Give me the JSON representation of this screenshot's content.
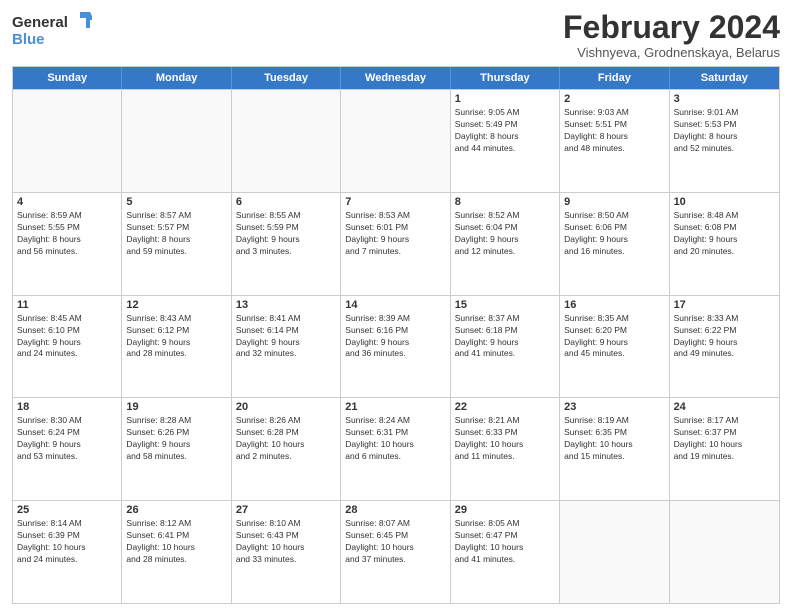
{
  "header": {
    "logo_line1": "General",
    "logo_line2": "Blue",
    "month_title": "February 2024",
    "location": "Vishnyeva, Grodnenskaya, Belarus"
  },
  "days_of_week": [
    "Sunday",
    "Monday",
    "Tuesday",
    "Wednesday",
    "Thursday",
    "Friday",
    "Saturday"
  ],
  "weeks": [
    [
      {
        "day": "",
        "info": ""
      },
      {
        "day": "",
        "info": ""
      },
      {
        "day": "",
        "info": ""
      },
      {
        "day": "",
        "info": ""
      },
      {
        "day": "1",
        "info": "Sunrise: 9:05 AM\nSunset: 5:49 PM\nDaylight: 8 hours\nand 44 minutes."
      },
      {
        "day": "2",
        "info": "Sunrise: 9:03 AM\nSunset: 5:51 PM\nDaylight: 8 hours\nand 48 minutes."
      },
      {
        "day": "3",
        "info": "Sunrise: 9:01 AM\nSunset: 5:53 PM\nDaylight: 8 hours\nand 52 minutes."
      }
    ],
    [
      {
        "day": "4",
        "info": "Sunrise: 8:59 AM\nSunset: 5:55 PM\nDaylight: 8 hours\nand 56 minutes."
      },
      {
        "day": "5",
        "info": "Sunrise: 8:57 AM\nSunset: 5:57 PM\nDaylight: 8 hours\nand 59 minutes."
      },
      {
        "day": "6",
        "info": "Sunrise: 8:55 AM\nSunset: 5:59 PM\nDaylight: 9 hours\nand 3 minutes."
      },
      {
        "day": "7",
        "info": "Sunrise: 8:53 AM\nSunset: 6:01 PM\nDaylight: 9 hours\nand 7 minutes."
      },
      {
        "day": "8",
        "info": "Sunrise: 8:52 AM\nSunset: 6:04 PM\nDaylight: 9 hours\nand 12 minutes."
      },
      {
        "day": "9",
        "info": "Sunrise: 8:50 AM\nSunset: 6:06 PM\nDaylight: 9 hours\nand 16 minutes."
      },
      {
        "day": "10",
        "info": "Sunrise: 8:48 AM\nSunset: 6:08 PM\nDaylight: 9 hours\nand 20 minutes."
      }
    ],
    [
      {
        "day": "11",
        "info": "Sunrise: 8:45 AM\nSunset: 6:10 PM\nDaylight: 9 hours\nand 24 minutes."
      },
      {
        "day": "12",
        "info": "Sunrise: 8:43 AM\nSunset: 6:12 PM\nDaylight: 9 hours\nand 28 minutes."
      },
      {
        "day": "13",
        "info": "Sunrise: 8:41 AM\nSunset: 6:14 PM\nDaylight: 9 hours\nand 32 minutes."
      },
      {
        "day": "14",
        "info": "Sunrise: 8:39 AM\nSunset: 6:16 PM\nDaylight: 9 hours\nand 36 minutes."
      },
      {
        "day": "15",
        "info": "Sunrise: 8:37 AM\nSunset: 6:18 PM\nDaylight: 9 hours\nand 41 minutes."
      },
      {
        "day": "16",
        "info": "Sunrise: 8:35 AM\nSunset: 6:20 PM\nDaylight: 9 hours\nand 45 minutes."
      },
      {
        "day": "17",
        "info": "Sunrise: 8:33 AM\nSunset: 6:22 PM\nDaylight: 9 hours\nand 49 minutes."
      }
    ],
    [
      {
        "day": "18",
        "info": "Sunrise: 8:30 AM\nSunset: 6:24 PM\nDaylight: 9 hours\nand 53 minutes."
      },
      {
        "day": "19",
        "info": "Sunrise: 8:28 AM\nSunset: 6:26 PM\nDaylight: 9 hours\nand 58 minutes."
      },
      {
        "day": "20",
        "info": "Sunrise: 8:26 AM\nSunset: 6:28 PM\nDaylight: 10 hours\nand 2 minutes."
      },
      {
        "day": "21",
        "info": "Sunrise: 8:24 AM\nSunset: 6:31 PM\nDaylight: 10 hours\nand 6 minutes."
      },
      {
        "day": "22",
        "info": "Sunrise: 8:21 AM\nSunset: 6:33 PM\nDaylight: 10 hours\nand 11 minutes."
      },
      {
        "day": "23",
        "info": "Sunrise: 8:19 AM\nSunset: 6:35 PM\nDaylight: 10 hours\nand 15 minutes."
      },
      {
        "day": "24",
        "info": "Sunrise: 8:17 AM\nSunset: 6:37 PM\nDaylight: 10 hours\nand 19 minutes."
      }
    ],
    [
      {
        "day": "25",
        "info": "Sunrise: 8:14 AM\nSunset: 6:39 PM\nDaylight: 10 hours\nand 24 minutes."
      },
      {
        "day": "26",
        "info": "Sunrise: 8:12 AM\nSunset: 6:41 PM\nDaylight: 10 hours\nand 28 minutes."
      },
      {
        "day": "27",
        "info": "Sunrise: 8:10 AM\nSunset: 6:43 PM\nDaylight: 10 hours\nand 33 minutes."
      },
      {
        "day": "28",
        "info": "Sunrise: 8:07 AM\nSunset: 6:45 PM\nDaylight: 10 hours\nand 37 minutes."
      },
      {
        "day": "29",
        "info": "Sunrise: 8:05 AM\nSunset: 6:47 PM\nDaylight: 10 hours\nand 41 minutes."
      },
      {
        "day": "",
        "info": ""
      },
      {
        "day": "",
        "info": ""
      }
    ]
  ]
}
